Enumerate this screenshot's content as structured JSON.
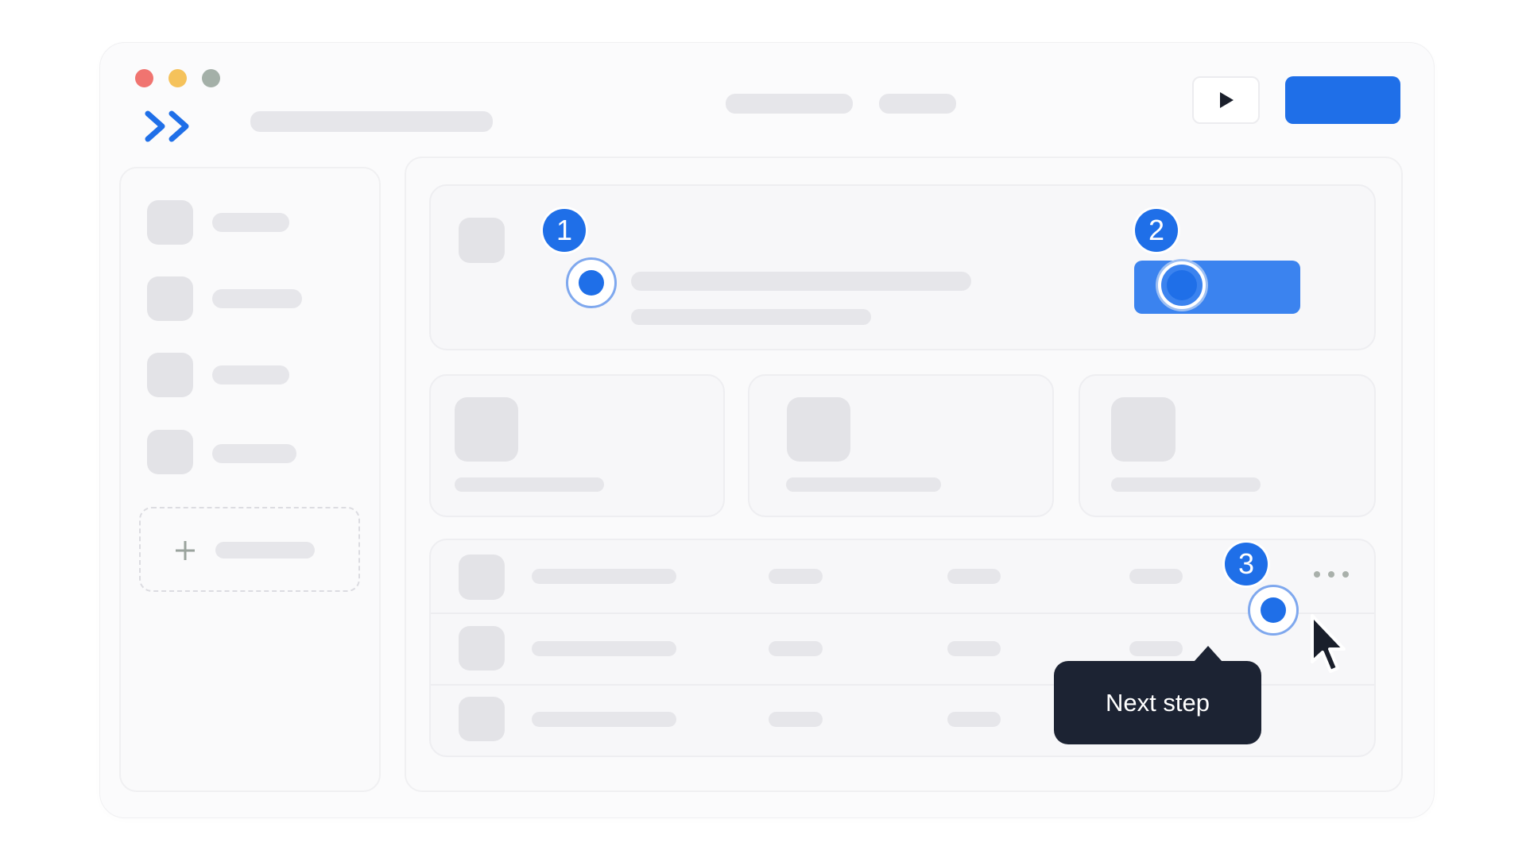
{
  "icons": {
    "logo": "double-chevron-right-icon",
    "play": "play-icon",
    "add": "plus-icon",
    "more": "more-horizontal-icon",
    "cursor": "mouse-pointer-icon"
  },
  "steps": {
    "step1": "1",
    "step2": "2",
    "step3": "3"
  },
  "tooltip": {
    "text": "Next step"
  },
  "colors": {
    "accent": "#1f6fe8",
    "traffic_red": "#f07470",
    "traffic_yellow": "#f5c25b",
    "traffic_gray": "#a4b0a8",
    "tooltip_bg": "#1c2333"
  }
}
